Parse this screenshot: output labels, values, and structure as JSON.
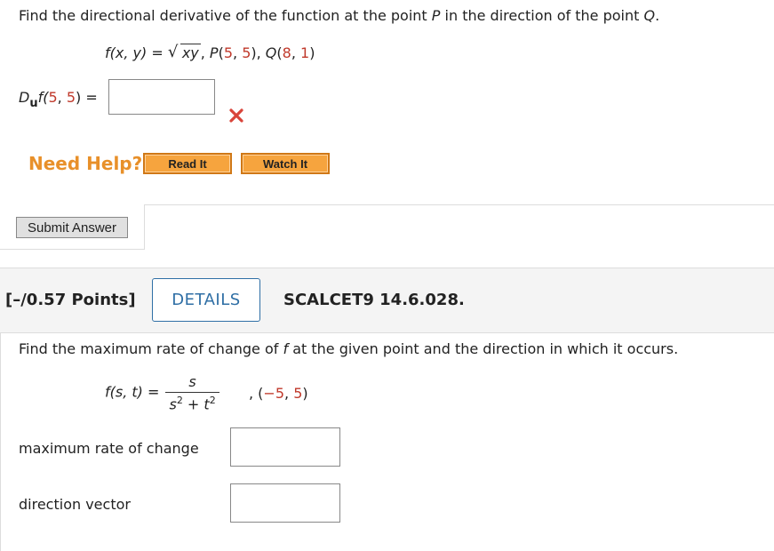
{
  "q1": {
    "prompt_a": "Find the directional derivative of the function at the point ",
    "prompt_p": "P",
    "prompt_b": " in the direction of the point ",
    "prompt_q": "Q",
    "prompt_c": ".",
    "func_lhs": "f(x, y) = ",
    "func_radicand": "xy",
    "func_sep": ",   ",
    "point_p_name": "P",
    "point_p_open": "(",
    "point_p_x": "5",
    "point_p_comma": ", ",
    "point_p_y": "5",
    "point_p_close": "),   ",
    "point_q_name": "Q",
    "point_q_open": "(",
    "point_q_x": "8",
    "point_q_comma": ", ",
    "point_q_y": "1",
    "point_q_close": ")",
    "answer_label_d": "D",
    "answer_label_sub": "u",
    "answer_label_f": "f(",
    "answer_label_x": "5",
    "answer_label_comma": ", ",
    "answer_label_y": "5",
    "answer_label_close": ")  =",
    "answer_value": "",
    "status": "incorrect",
    "need_help": "Need Help?",
    "read_it": "Read It",
    "watch_it": "Watch It",
    "submit": "Submit Answer"
  },
  "q2": {
    "points": "[–/0.57 Points]",
    "details": "DETAILS",
    "course_code": "SCALCET9 14.6.028.",
    "prompt_a": "Find the maximum rate of change of ",
    "prompt_f": "f",
    "prompt_b": " at the given point and the direction in which it occurs.",
    "func_lhs": "f(s, t) = ",
    "func_num": "s",
    "func_den_s": "s",
    "func_den_exp1": "2",
    "func_den_plus": " + ",
    "func_den_t": "t",
    "func_den_exp2": "2",
    "point_open": ",    (",
    "point_x": "−5",
    "point_comma": ", ",
    "point_y": "5",
    "point_close": ")",
    "max_rate_label": "maximum rate of change",
    "max_rate_value": "",
    "direction_label": "direction vector",
    "direction_value": ""
  },
  "colors": {
    "value_red": "#c0392b",
    "help_orange": "#e8902a",
    "button_orange": "#f6a43e",
    "details_blue": "#2f6fa5",
    "error_x": "#d9443a"
  }
}
